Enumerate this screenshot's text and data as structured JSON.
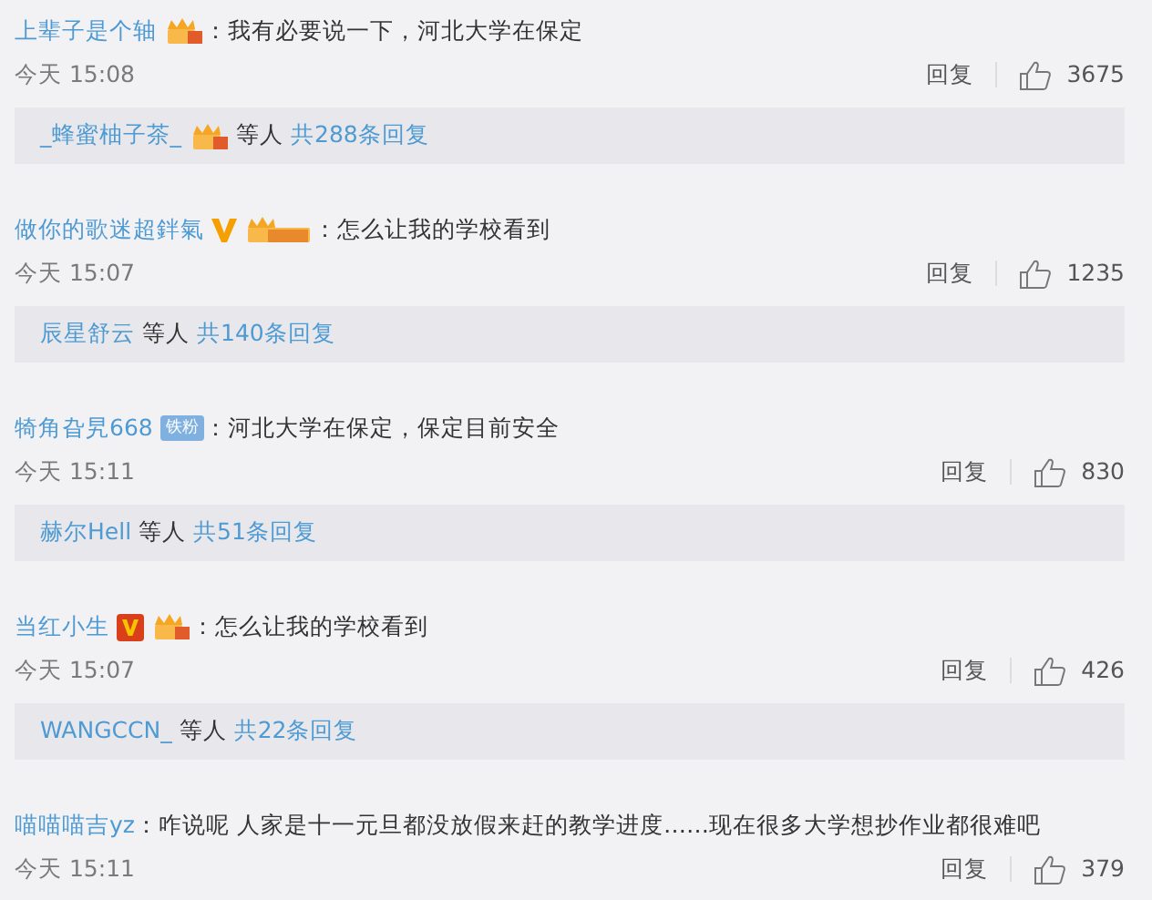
{
  "comments": [
    {
      "author": "上辈子是个轴",
      "badges": [
        {
          "kind": "fan"
        }
      ],
      "text": "：我有必要说一下，河北大学在保定",
      "time": "今天 15:08",
      "reply_label": "回复",
      "likes": "3675",
      "thread": {
        "names": "_蜂蜜柚子茶_",
        "badges": [
          {
            "kind": "fan"
          }
        ],
        "etc": "等人",
        "count": "共288条回复"
      }
    },
    {
      "author": "做你的歌迷超鉡氣",
      "badges": [
        {
          "kind": "verified"
        },
        {
          "kind": "fan-tag"
        }
      ],
      "text": "：怎么让我的学校看到",
      "time": "今天 15:07",
      "reply_label": "回复",
      "likes": "1235",
      "thread": {
        "names": "辰星舒云",
        "etc": "等人",
        "count": "共140条回复"
      }
    },
    {
      "author": "犄角旮旯668",
      "badges": [
        {
          "kind": "label",
          "label": "铁粉"
        }
      ],
      "text": "：河北大学在保定，保定目前安全",
      "time": "今天 15:11",
      "reply_label": "回复",
      "likes": "830",
      "thread": {
        "names": "赫尔Hell",
        "etc": "等人",
        "count": "共51条回复"
      }
    },
    {
      "author": "当红小生",
      "badges": [
        {
          "kind": "vip"
        },
        {
          "kind": "fan"
        }
      ],
      "text": "：怎么让我的学校看到",
      "time": "今天 15:07",
      "reply_label": "回复",
      "likes": "426",
      "thread": {
        "names": "WANGCCN_",
        "etc": "等人",
        "count": "共22条回复"
      }
    },
    {
      "author": "喵喵喵吉yz",
      "text": "：咋说呢 人家是十一元旦都没放假来赶的教学进度……现在很多大学想抄作业都很难吧",
      "time": "今天 15:11",
      "reply_label": "回复",
      "likes": "379"
    }
  ]
}
